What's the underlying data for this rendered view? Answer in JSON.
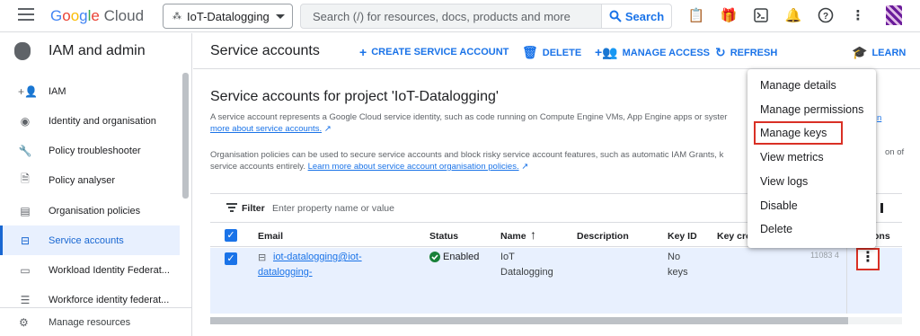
{
  "topbar": {
    "logo": {
      "g1": "G",
      "g2": "o",
      "g3": "o",
      "g4": "g",
      "g5": "l",
      "g6": "e",
      "cloud": " Cloud"
    },
    "project": "IoT-Datalogging",
    "search_placeholder": "Search (/) for resources, docs, products and more",
    "search_button": "Search",
    "icons": [
      "notes-icon",
      "gift-icon",
      "terminal-icon",
      "bell-icon",
      "help-icon",
      "more-vert-icon"
    ]
  },
  "sidebar": {
    "title": "IAM and admin",
    "items": [
      {
        "label": "IAM",
        "icon": "person-add-icon"
      },
      {
        "label": "Identity and organisation",
        "icon": "account-circle-icon"
      },
      {
        "label": "Policy troubleshooter",
        "icon": "wrench-icon"
      },
      {
        "label": "Policy analyser",
        "icon": "document-search-icon"
      },
      {
        "label": "Organisation policies",
        "icon": "article-icon"
      },
      {
        "label": "Service accounts",
        "icon": "service-account-icon"
      },
      {
        "label": "Workload Identity Federat...",
        "icon": "badge-icon"
      },
      {
        "label": "Workforce identity federat...",
        "icon": "list-icon"
      }
    ],
    "footer": "Manage resources"
  },
  "actionbar": {
    "title": "Service accounts",
    "create": "CREATE SERVICE ACCOUNT",
    "delete": "DELETE",
    "manage_access": "MANAGE ACCESS",
    "refresh": "REFRESH",
    "learn": "LEARN"
  },
  "content": {
    "heading": "Service accounts for project 'IoT-Datalogging'",
    "desc1": "A service account represents a Google Cloud service identity, such as code running on Compute Engine VMs, App Engine apps or syster",
    "desc1_link": "more about service accounts.",
    "desc1_trailing_link": "n",
    "desc2": "Organisation policies can be used to secure service accounts and block risky service account features, such as automatic IAM Grants, k",
    "desc2_trail": "on of",
    "desc2_line2": "service accounts entirely.",
    "desc2_link": "Learn more about service account organisation policies."
  },
  "table": {
    "filter_label": "Filter",
    "filter_placeholder": "Enter property name or value",
    "columns": [
      "Email",
      "Status",
      "Name",
      "Description",
      "Key ID",
      "Key crea",
      "ons"
    ],
    "rows": [
      {
        "email_line1": "iot-datalogging@iot-",
        "email_line2": "datalogging-",
        "status": "Enabled",
        "name_line1": "IoT",
        "name_line2": "Datalogging",
        "key_line1": "No",
        "key_line2": "keys",
        "created": "11083 4"
      }
    ]
  },
  "menu": {
    "items": [
      "Manage details",
      "Manage permissions",
      "Manage keys",
      "View metrics",
      "View logs",
      "Disable",
      "Delete"
    ]
  },
  "colors": {
    "accent": "#1a73e8",
    "highlight": "#d93025",
    "selected_row": "#e8f0fe"
  }
}
